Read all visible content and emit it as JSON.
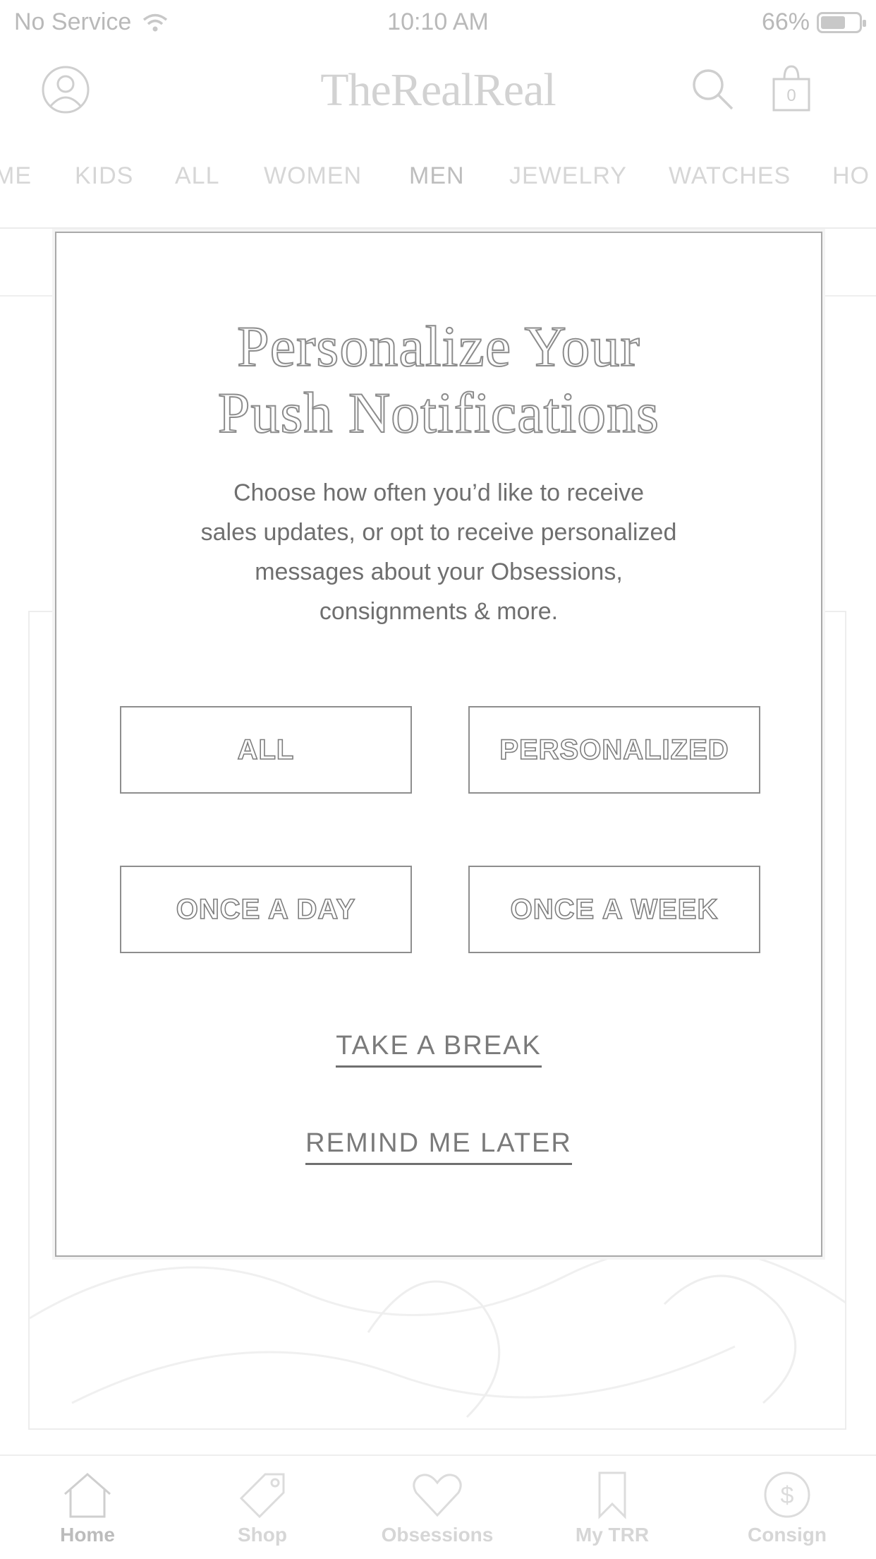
{
  "status_bar": {
    "carrier": "No Service",
    "time": "10:10 AM",
    "battery_percent": "66%",
    "battery_level": 0.66
  },
  "header": {
    "logo": "TheRealReal",
    "bag_count": "0",
    "icons": [
      "profile-icon",
      "search-icon",
      "shopping-bag-icon"
    ]
  },
  "categories": {
    "items": [
      "ME",
      "KIDS",
      "ALL",
      "WOMEN",
      "MEN",
      "JEWELRY",
      "WATCHES",
      "HO"
    ],
    "active": "MEN"
  },
  "modal": {
    "title_line1": "Personalize Your",
    "title_line2": "Push Notifications",
    "body_line1": "Choose how often you’d like to receive",
    "body_line2": "sales updates, or opt to receive personalized",
    "body_line3": "messages about your Obsessions,",
    "body_line4": "consignments & more.",
    "options": {
      "all": "ALL",
      "personalized": "PERSONALIZED",
      "once_a_day": "ONCE A DAY",
      "once_a_week": "ONCE A WEEK"
    },
    "take_a_break": "TAKE A BREAK",
    "remind_me_later": "REMIND ME LATER"
  },
  "tab_bar": {
    "tabs": [
      {
        "label": "Home",
        "icon": "home-icon"
      },
      {
        "label": "Shop",
        "icon": "tag-icon"
      },
      {
        "label": "Obsessions",
        "icon": "heart-icon"
      },
      {
        "label": "My TRR",
        "icon": "bookmark-icon"
      },
      {
        "label": "Consign",
        "icon": "dollar-circle-icon"
      }
    ],
    "active": "Home"
  },
  "colors": {
    "modal_border": "#a9a9a9",
    "text_dim": "#d6d6d6",
    "text_body": "#6f6f6f"
  }
}
